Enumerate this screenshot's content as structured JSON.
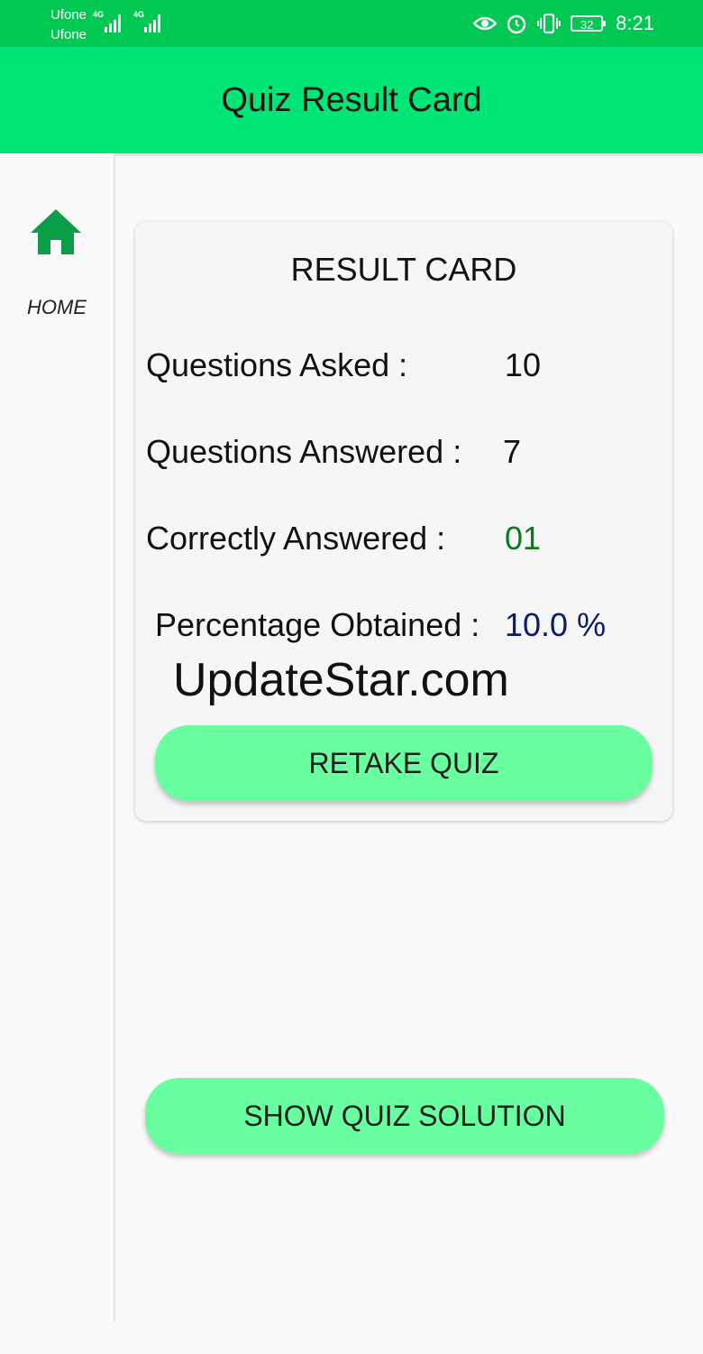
{
  "status_bar": {
    "carrier_1": "Ufone",
    "carrier_2": "Ufone",
    "network_1": "4G",
    "network_2": "4G",
    "battery": "32",
    "time": "8:21",
    "icons": [
      "eye-comfort-icon",
      "alarm-icon",
      "vibrate-icon",
      "battery-icon"
    ]
  },
  "app_bar": {
    "title": "Quiz Result Card"
  },
  "sidebar": {
    "home_label": "HOME",
    "home_icon": "home-icon",
    "icon_color": "#0a9e48"
  },
  "card": {
    "title": "RESULT CARD",
    "rows": [
      {
        "label": "Questions Asked :",
        "value": "10",
        "value_color": "#111111"
      },
      {
        "label": "Questions Answered :",
        "value": "7",
        "value_color": "#111111"
      },
      {
        "label": "Correctly Answered :",
        "value": "01",
        "value_color": "#0a7a1e"
      },
      {
        "label": "Percentage Obtained :",
        "value": "10.0 %",
        "value_color": "#0d1b6b"
      }
    ],
    "watermark": "UpdateStar.com",
    "retake_label": "RETAKE QUIZ"
  },
  "solution_label": "SHOW QUIZ SOLUTION",
  "colors": {
    "status_bar": "#00c853",
    "app_bar": "#00e676",
    "button": "#69ffa0"
  }
}
